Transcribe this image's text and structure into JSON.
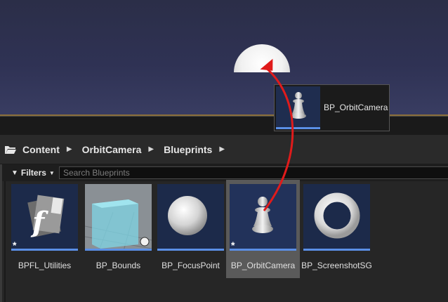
{
  "viewport": {
    "horizon_color": "#8a6f3a"
  },
  "breadcrumb": {
    "items": [
      "Content",
      "OrbitCamera",
      "Blueprints"
    ]
  },
  "filter_bar": {
    "filters_label": "Filters",
    "search_placeholder": "Search Blueprints"
  },
  "assets": [
    {
      "label": "BPFL_Utilities",
      "icon": "function-library-icon"
    },
    {
      "label": "BP_Bounds",
      "icon": "bounds-volume-icon"
    },
    {
      "label": "BP_FocusPoint",
      "icon": "sphere-icon"
    },
    {
      "label": "BP_OrbitCamera",
      "icon": "pawn-icon",
      "selected": true
    },
    {
      "label": "BP_ScreenshotSG",
      "icon": "torus-icon"
    }
  ],
  "drag_tooltip": {
    "label": "BP_OrbitCamera",
    "icon": "pawn-icon"
  },
  "colors": {
    "accent": "#5b8fe6",
    "arrow": "#e01b1b",
    "tile_bg": "#1c2a4a"
  }
}
